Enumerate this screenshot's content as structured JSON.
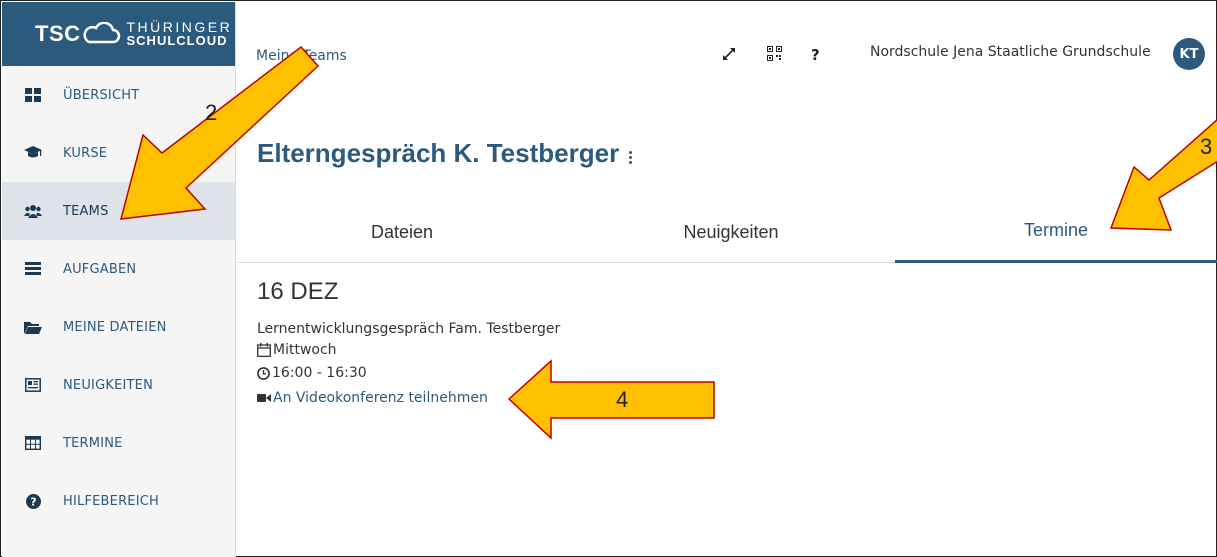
{
  "logo": {
    "tsc": "TSC",
    "line1": "THÜRINGER",
    "line2": "SCHULCLOUD"
  },
  "sidebar": {
    "items": [
      {
        "label": "ÜBERSICHT",
        "icon": "dashboard-icon"
      },
      {
        "label": "KURSE",
        "icon": "graduation-cap-icon"
      },
      {
        "label": "TEAMS",
        "icon": "users-icon",
        "active": true
      },
      {
        "label": "AUFGABEN",
        "icon": "tasks-icon"
      },
      {
        "label": "MEINE DATEIEN",
        "icon": "folder-icon"
      },
      {
        "label": "NEUIGKEITEN",
        "icon": "newspaper-icon"
      },
      {
        "label": "TERMINE",
        "icon": "calendar-grid-icon"
      },
      {
        "label": "HILFEBEREICH",
        "icon": "help-icon"
      }
    ]
  },
  "header": {
    "breadcrumb": "Meine Teams",
    "fullscreen_icon": "expand-icon",
    "qr_icon": "qr-code-icon",
    "help_label": "?",
    "school": "Nordschule Jena Staatliche Grundschule",
    "avatar_initials": "KT"
  },
  "main": {
    "title": "Elterngespräch K. Testberger",
    "tabs": [
      {
        "label": "Dateien"
      },
      {
        "label": "Neuigkeiten"
      },
      {
        "label": "Termine",
        "active": true
      }
    ],
    "event": {
      "date": "16 DEZ",
      "title": "Lernentwicklungsgespräch Fam. Testberger",
      "weekday": "Mittwoch",
      "time": "16:00 - 16:30",
      "video_link": "An Videokonferenz teilnehmen"
    }
  },
  "annotations": {
    "n2": "2",
    "n3": "3",
    "n4": "4"
  },
  "colors": {
    "brand": "#2c5a7c",
    "arrow_fill": "#ffc000",
    "arrow_stroke": "#c00000",
    "active_bg": "#dde3e9"
  }
}
